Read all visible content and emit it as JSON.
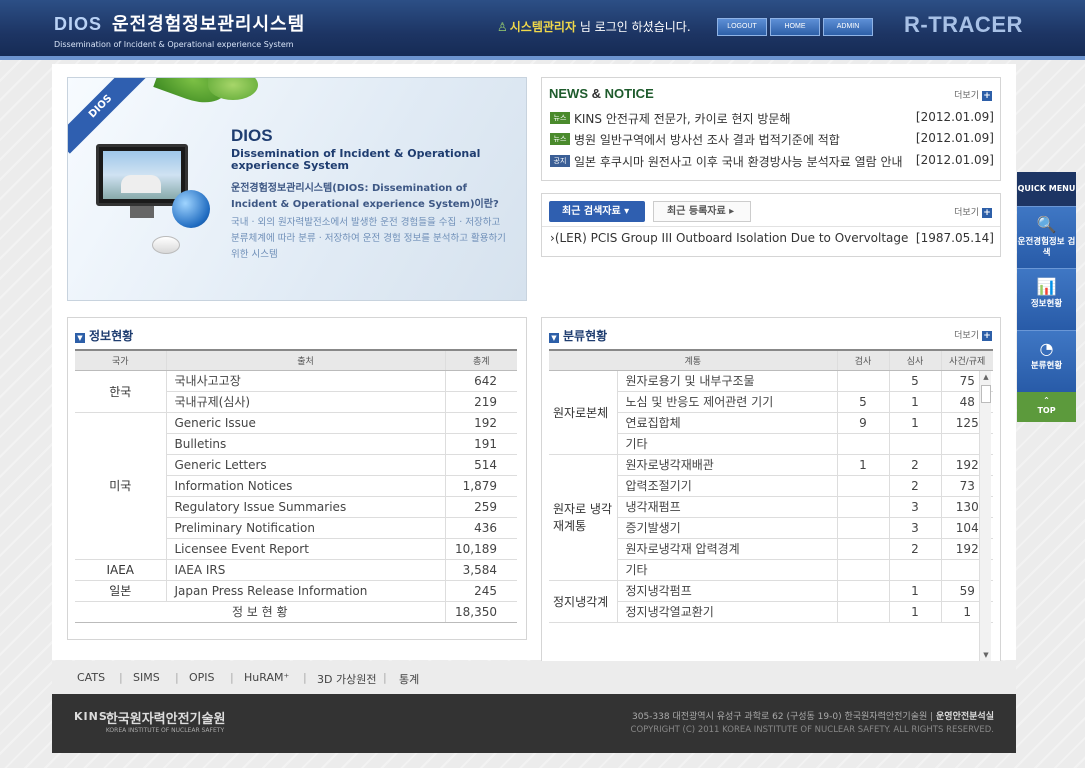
{
  "header": {
    "logo_big": "DIOS",
    "logo_kr": "운전경험정보관리시스템",
    "logo_sub": "Dissemination of Incident & Operational experience System",
    "login_user": "시스템관리자",
    "login_msg": " 님 로그인 하셨습니다.",
    "buttons": [
      "LOGOUT",
      "HOME",
      "ADMIN"
    ],
    "brand": "R-TRACER"
  },
  "banner": {
    "ribbon": "DIOS",
    "title": "DIOS",
    "subtitle": "Dissemination of Incident & Operational experience System",
    "question": "운전경험정보관리시스템(DIOS: Dissemination of Incident & Operational experience System)이란?",
    "desc": "국내 · 외의 원자력발전소에서 발생한 운전 경험들을 수집 · 저장하고 분류체계에 따라 분류 · 저장하여 운전 경험 정보를 분석하고 활용하기 위한 시스템"
  },
  "notice": {
    "title_a": "NEWS",
    "title_amp": " & ",
    "title_b": "NOTICE",
    "more": "더보기",
    "items": [
      {
        "tag": "뉴스",
        "color": "#4a8a2c",
        "title": "KINS 안전규제 전문가, 카이로 현지 방문해",
        "date": "[2012.01.09]"
      },
      {
        "tag": "뉴스",
        "color": "#4a8a2c",
        "title": "병원 일반구역에서 방사선 조사 결과 법적기준에 적합",
        "date": "[2012.01.09]"
      },
      {
        "tag": "공지",
        "color": "#3b5f96",
        "title": "일본 후쿠시마 원전사고 이후 국내 환경방사능 분석자료 열람 안내",
        "date": "[2012.01.09]"
      }
    ]
  },
  "recent": {
    "tab_active": "최근 검색자료",
    "tab_inactive": "최근 등록자료",
    "more": "더보기",
    "item": {
      "title": "(LER) PCIS Group III Outboard Isolation Due to Overvoltage",
      "date": "[1987.05.14]"
    }
  },
  "stats": {
    "title": "정보현황",
    "headers": [
      "국가",
      "출처",
      "총계"
    ],
    "groups": [
      {
        "country": "한국",
        "rows": [
          [
            "국내사고고장",
            "642"
          ],
          [
            "국내규제(심사)",
            "219"
          ]
        ]
      },
      {
        "country": "미국",
        "rows": [
          [
            "Generic Issue",
            "192"
          ],
          [
            "Bulletins",
            "191"
          ],
          [
            "Generic Letters",
            "514"
          ],
          [
            "Information Notices",
            "1,879"
          ],
          [
            "Regulatory Issue Summaries",
            "259"
          ],
          [
            "Preliminary Notification",
            "436"
          ],
          [
            "Licensee Event Report",
            "10,189"
          ]
        ]
      },
      {
        "country": "IAEA",
        "rows": [
          [
            "IAEA IRS",
            "3,584"
          ]
        ]
      },
      {
        "country": "일본",
        "rows": [
          [
            "Japan Press Release Information",
            "245"
          ]
        ]
      }
    ],
    "total_label": "정 보 현 황",
    "total": "18,350"
  },
  "classification": {
    "title": "분류현황",
    "more": "더보기",
    "headers": [
      "계통",
      "검사",
      "심사",
      "사건/규제"
    ],
    "groups": [
      {
        "name": "원자로본체",
        "rows": [
          [
            "원자로용기 및 내부구조물",
            "",
            "5",
            "75"
          ],
          [
            "노심 및 반응도 제어관련 기기",
            "5",
            "1",
            "48"
          ],
          [
            "연료집합체",
            "9",
            "1",
            "125"
          ],
          [
            "기타",
            "",
            "",
            ""
          ]
        ]
      },
      {
        "name": "원자로 냉각재계통",
        "rows": [
          [
            "원자로냉각재배관",
            "1",
            "2",
            "192"
          ],
          [
            "압력조절기기",
            "",
            "2",
            "73"
          ],
          [
            "냉각재펌프",
            "",
            "3",
            "130"
          ],
          [
            "증기발생기",
            "",
            "3",
            "104"
          ],
          [
            "원자로냉각재 압력경계",
            "",
            "2",
            "192"
          ],
          [
            "기타",
            "",
            "",
            ""
          ]
        ]
      },
      {
        "name": "정지냉각계",
        "rows": [
          [
            "정지냉각펌프",
            "",
            "1",
            "59"
          ],
          [
            "정지냉각열교환기",
            "",
            "1",
            "1"
          ]
        ]
      }
    ]
  },
  "footnav": [
    "CATS",
    "SIMS",
    "OPIS",
    "HuRAM⁺",
    "3D 가상원전",
    "통계"
  ],
  "footer": {
    "logo_mark": "KINS",
    "org_kr": "한국원자력안전기술원",
    "org_en": "KOREA INSTITUTE OF NUCLEAR SAFETY",
    "address": "305-338 대전광역시 유성구 과학로 62 (구성동 19-0) 한국원자력안전기술원",
    "dept": "운영안전분석실",
    "copyright": "COPYRIGHT (C) 2011 KOREA INSTITUTE OF NUCLEAR SAFETY.  ALL RIGHTS RESERVED."
  },
  "quick": {
    "title": "QUICK MENU",
    "items": [
      {
        "icon": "search-icon",
        "glyph": "🔍",
        "label": "운전경험정보 검색"
      },
      {
        "icon": "chart-icon",
        "glyph": "📊",
        "label": "정보현황"
      },
      {
        "icon": "classify-icon",
        "glyph": "◔",
        "label": "분류현황"
      }
    ],
    "top": "TOP"
  }
}
